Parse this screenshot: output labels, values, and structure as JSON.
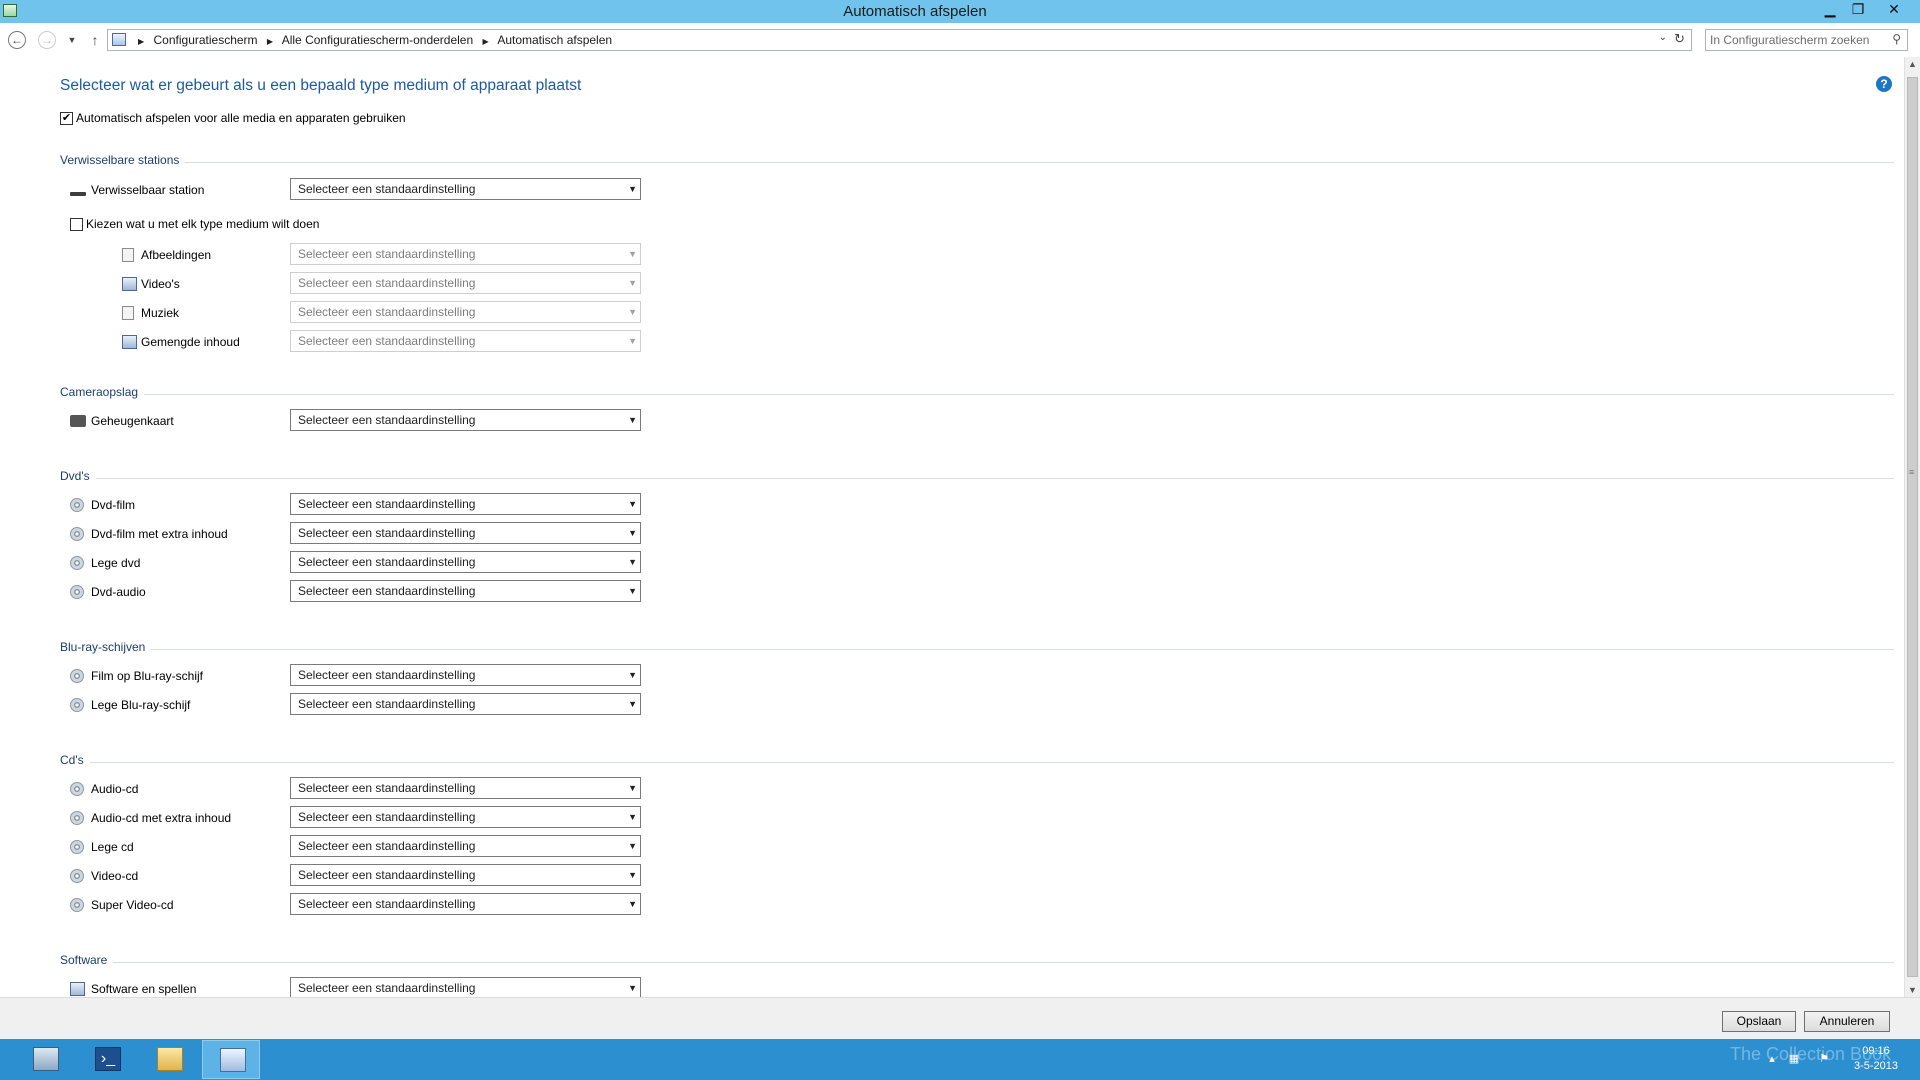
{
  "window": {
    "title": "Automatisch afspelen",
    "controls": {
      "minimize": "▁",
      "restore": "❐",
      "close": "✕"
    }
  },
  "nav": {
    "breadcrumbs": [
      "Configuratiescherm",
      "Alle Configuratiescherm-onderdelen",
      "Automatisch afspelen"
    ],
    "search_placeholder": "In Configuratiescherm zoeken"
  },
  "page": {
    "heading": "Selecteer wat er gebeurt als u een bepaald type medium of apparaat plaatst",
    "use_autoplay_label": "Automatisch afspelen voor alle media en apparaten gebruiken",
    "use_autoplay_checked": true,
    "default_select": "Selecteer een standaardinstelling"
  },
  "sections": {
    "removable": {
      "title": "Verwisselbare stations",
      "drive_label": "Verwisselbaar station",
      "choose_label": "Kiezen wat u met elk type medium wilt doen",
      "choose_checked": false,
      "sub_items": [
        "Afbeeldingen",
        "Video's",
        "Muziek",
        "Gemengde inhoud"
      ]
    },
    "camera": {
      "title": "Cameraopslag",
      "items": [
        "Geheugenkaart"
      ]
    },
    "dvd": {
      "title": "Dvd's",
      "items": [
        "Dvd-film",
        "Dvd-film met extra inhoud",
        "Lege dvd",
        "Dvd-audio"
      ]
    },
    "bluray": {
      "title": "Blu-ray-schijven",
      "items": [
        "Film op Blu-ray-schijf",
        "Lege Blu-ray-schijf"
      ]
    },
    "cd": {
      "title": "Cd's",
      "items": [
        "Audio-cd",
        "Audio-cd met extra inhoud",
        "Lege cd",
        "Video-cd",
        "Super Video-cd"
      ]
    },
    "software": {
      "title": "Software",
      "items": [
        "Software en spellen"
      ]
    }
  },
  "buttons": {
    "save": "Opslaan",
    "cancel": "Annuleren"
  },
  "taskbar": {
    "watermark": "The Collection Book",
    "time": "09:16",
    "date": "3-5-2013"
  },
  "colors": {
    "titlebar": "#6fc3ec",
    "heading": "#1e5aa0",
    "taskbar": "#2c8fd0"
  }
}
